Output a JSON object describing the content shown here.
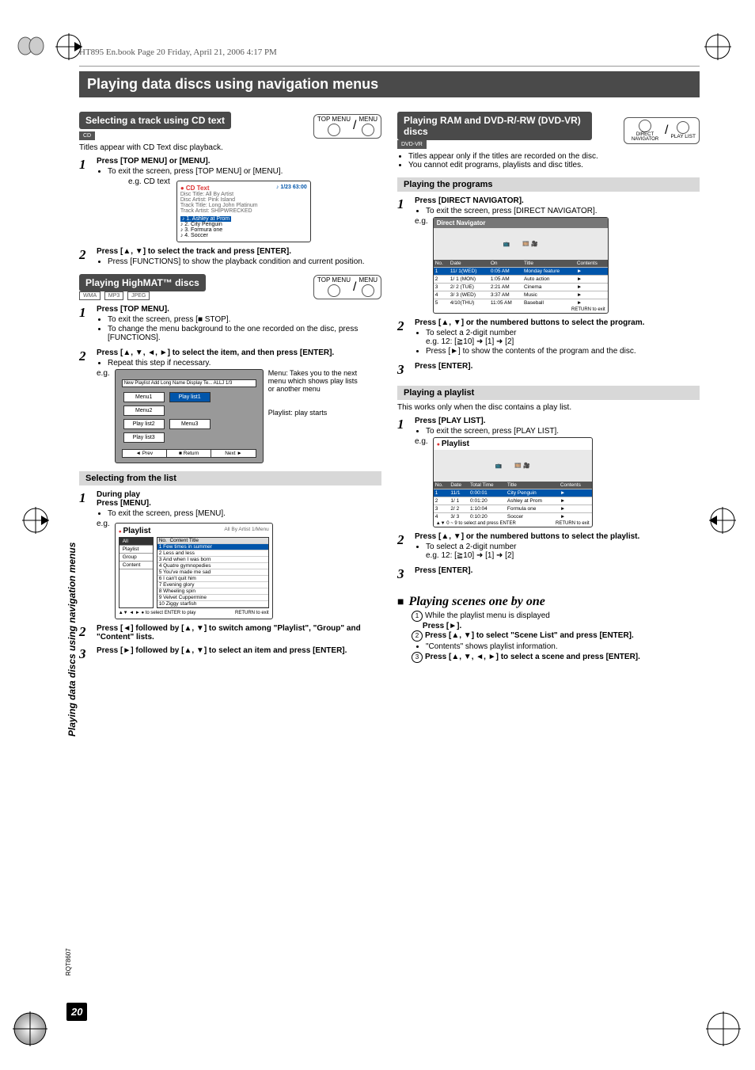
{
  "header_runner": "HT895 En.book  Page 20  Friday, April 21, 2006  4:17 PM",
  "page_number": "20",
  "rqt": "RQT8607",
  "side_tab_text": "Playing data discs using navigation menus",
  "main_title": "Playing data discs using navigation menus",
  "left": {
    "cdtext": {
      "pill": "Selecting a track using CD text",
      "tag": "CD",
      "topmenu": "TOP MENU",
      "menu": "MENU",
      "intro": "Titles appear with CD Text disc playback.",
      "step1_b": "Press [TOP MENU] or [MENU].",
      "step1_li": "To exit the screen, press [TOP MENU] or [MENU].",
      "eg_label": "e.g. CD text",
      "fig": {
        "title": "CD Text",
        "counter": "1/23 63:00",
        "l1": "Disc Title:    All By Artist",
        "l2": "Disc Artist:  Pink Island",
        "l3": "Track Title:  Long John Platinum",
        "l4": "Track Artist: SHIPWRECKED",
        "r1": "1. Ashley at Prom",
        "r2": "2. City Penguin",
        "r3": "3. Formura one",
        "r4": "4. Soccer"
      },
      "step2_b": "Press [▲, ▼] to select the track and press [ENTER].",
      "step2_li": "Press [FUNCTIONS] to show the playback condition and current position."
    },
    "highmat": {
      "pill": "Playing HighMAT™ discs",
      "tags": [
        "WMA",
        "MP3",
        "JPEG"
      ],
      "topmenu": "TOP MENU",
      "menu": "MENU",
      "step1_b": "Press [TOP MENU].",
      "step1_li1": "To exit the screen, press [■ STOP].",
      "step1_li2": "To change the menu background to the one recorded on the disc, press [FUNCTIONS].",
      "step2_b": "Press [▲, ▼, ◄, ►] to select the item, and then press [ENTER].",
      "step2_li": "Repeat this step if necessary.",
      "eg": "e.g.",
      "callout_menu": "Menu: Takes you to the next menu which shows play lists or another menu",
      "callout_playlist": "Playlist:  play starts",
      "grid": {
        "top": "New Playlist Add  Long Name Display Te...  ALLJ  1/3",
        "cells": [
          "Menu1",
          "Play list1",
          "Menu2",
          "Play list2",
          "Menu3",
          "Play list3"
        ],
        "btns": [
          "◄ Prev",
          "■ Return",
          "Next ►"
        ]
      }
    },
    "selecting": {
      "bar": "Selecting from the list",
      "step1_a": "During play",
      "step1_b": "Press [MENU].",
      "step1_li": "To exit the screen, press [MENU].",
      "eg": "e.g.",
      "fig": {
        "hdr": "Playlist",
        "meta": "All  By Artist       1/Menu",
        "menu_sel": "All",
        "menu": [
          "Playlist",
          "Group",
          "Content"
        ],
        "colh": [
          "No.",
          "Content Title"
        ],
        "rows": [
          "1  Few times in summer",
          "2  Less and less",
          "3  And when I was born",
          "4  Quatre gymnopedies",
          "5  You've made me sad",
          "6  I can't quit him",
          "7  Evening glory",
          "8  Wheeling spin",
          "9  Velvet Cuppermine",
          "10  Ziggy starfish"
        ],
        "ftr_l": "▲▼ ◄ ► ● to select  ENTER to play",
        "ftr_r": "RETURN to exit"
      },
      "step2_b": "Press [◄] followed by [▲, ▼] to switch among \"Playlist\", \"Group\" and \"Content\" lists.",
      "step3_b": "Press [►] followed by [▲, ▼] to select an item and press [ENTER]."
    }
  },
  "right": {
    "ram": {
      "pill": "Playing RAM and DVD-R/-RW (DVD-VR) discs",
      "tag": "DVD-VR",
      "btn_l": "DIRECT NAVIGATOR",
      "btn_r": "PLAY LIST",
      "li1": "Titles appear only if the titles are recorded on the disc.",
      "li2": "You cannot edit programs, playlists and disc titles."
    },
    "programs": {
      "bar": "Playing the programs",
      "step1_b": "Press [DIRECT NAVIGATOR].",
      "step1_li": "To exit the screen, press [DIRECT NAVIGATOR].",
      "eg": "e.g.",
      "fig": {
        "title": "Direct Navigator",
        "cols": [
          "No.",
          "Date",
          "On",
          "Title",
          "Contents"
        ],
        "rows": [
          [
            "1",
            "11/ 1(WED)",
            "0:05 AM",
            "Monday feature",
            ""
          ],
          [
            "2",
            "1/ 1 (MON)",
            "1:05 AM",
            "Auto action",
            ""
          ],
          [
            "3",
            "2/ 2 (TUE)",
            "2:21 AM",
            "Cinema",
            ""
          ],
          [
            "4",
            "3/ 3 (WED)",
            "3:37 AM",
            "Music",
            ""
          ],
          [
            "5",
            "4/10(THU)",
            "11:05 AM",
            "Baseball",
            ""
          ]
        ],
        "ftr_r": "RETURN to exit"
      },
      "step2_b": "Press [▲, ▼] or the numbered buttons to select the program.",
      "step2_li1": "To select a 2-digit number",
      "step2_li1b": "e.g. 12: [≧10] ➜ [1] ➜ [2]",
      "step2_li2": "Press [►] to show the contents of the program and the disc.",
      "step3_b": "Press [ENTER]."
    },
    "playlist": {
      "bar": "Playing a playlist",
      "intro": "This works only when the disc contains a play list.",
      "step1_b": "Press [PLAY LIST].",
      "step1_li": "To exit the screen, press [PLAY LIST].",
      "eg": "e.g.",
      "fig": {
        "title": "Playlist",
        "cols": [
          "No.",
          "Date",
          "Total Time",
          "Title",
          "Contents"
        ],
        "rows": [
          [
            "1",
            "11/1",
            "0:00:01",
            "City Penguin",
            ""
          ],
          [
            "2",
            "1/ 1",
            "0:01:20",
            "Ashley at Prom",
            ""
          ],
          [
            "3",
            "2/ 2",
            "1:10:04",
            "Formula one",
            ""
          ],
          [
            "4",
            "3/ 3",
            "0:10:20",
            "Soccer",
            ""
          ]
        ],
        "ftr_l": "▲▼ 0 ~ 9 to select and press ENTER",
        "ftr_r": "RETURN to exit"
      },
      "step2_b": "Press [▲, ▼] or the numbered buttons to select the playlist.",
      "step2_li1": "To select a 2-digit number",
      "step2_li1b": "e.g. 12: [≧10] ➜ [1] ➜ [2]",
      "step3_b": "Press [ENTER]."
    },
    "scenes": {
      "heading": "Playing scenes one by one",
      "s1a": "While the playlist menu is displayed",
      "s1b": "Press [►].",
      "s2a": "Press [▲, ▼] to select \"Scene List\" and press [ENTER].",
      "s2b": "\"Contents\" shows playlist information.",
      "s3": "Press [▲, ▼, ◄, ►] to select a scene and press [ENTER]."
    }
  }
}
